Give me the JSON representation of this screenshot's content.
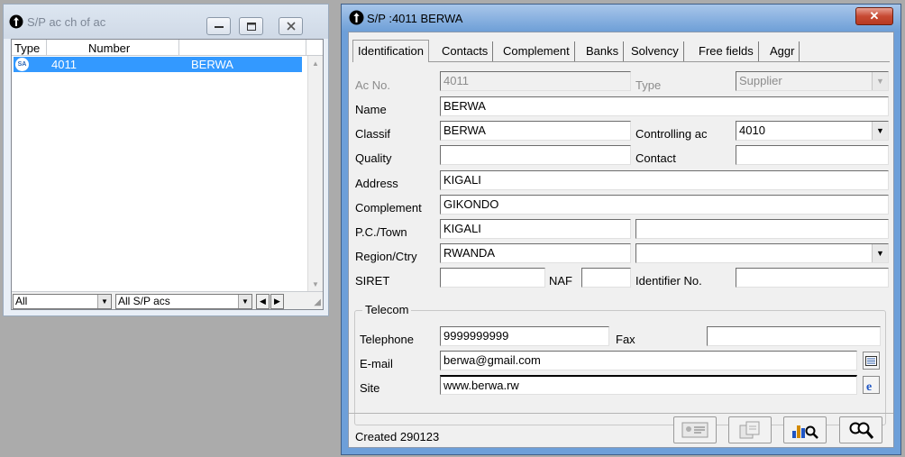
{
  "list_window": {
    "title": "S/P ac ch of ac",
    "columns": [
      "Type",
      "Number",
      ""
    ],
    "rows": [
      {
        "type_badge": "SA",
        "number": "4011",
        "name": "BERWA"
      }
    ],
    "filter_type": "All",
    "filter_scope": "All S/P acs"
  },
  "detail_window": {
    "title": "S/P :4011 BERWA",
    "close_glyph": "✕",
    "tabs": [
      "Identification",
      "Contacts",
      "Complement",
      "Banks",
      "Solvency",
      "Free fields",
      "Aggr"
    ],
    "active_tab": "Identification",
    "fields": {
      "ac_no_label": "Ac No.",
      "ac_no": "4011",
      "type_label": "Type",
      "type": "Supplier",
      "name_label": "Name",
      "name": "BERWA",
      "classif_label": "Classif",
      "classif": "BERWA",
      "controlling_label": "Controlling ac",
      "controlling": "4010",
      "quality_label": "Quality",
      "quality": "",
      "contact_label": "Contact",
      "contact": "",
      "address_label": "Address",
      "address": "KIGALI",
      "complement_label": "Complement",
      "complement": "GIKONDO",
      "pc_town_label": "P.C./Town",
      "pc": "KIGALI",
      "town": "",
      "region_label": "Region/Ctry",
      "region": "RWANDA",
      "country": "",
      "siret_label": "SIRET",
      "siret": "",
      "naf_label": "NAF",
      "naf": "",
      "identifier_label": "Identifier No.",
      "identifier": ""
    },
    "telecom": {
      "group_label": "Telecom",
      "telephone_label": "Telephone",
      "telephone": "9999999999",
      "fax_label": "Fax",
      "fax": "",
      "email_label": "E-mail",
      "email": "berwa@gmail.com",
      "site_label": "Site",
      "site": "www.berwa.rw"
    },
    "status": "Created 290123"
  },
  "colors": {
    "selection": "#3399ff",
    "title_bar_active": "#6e9fd7",
    "close_button": "#c74a33",
    "desktop": "#ababab"
  }
}
